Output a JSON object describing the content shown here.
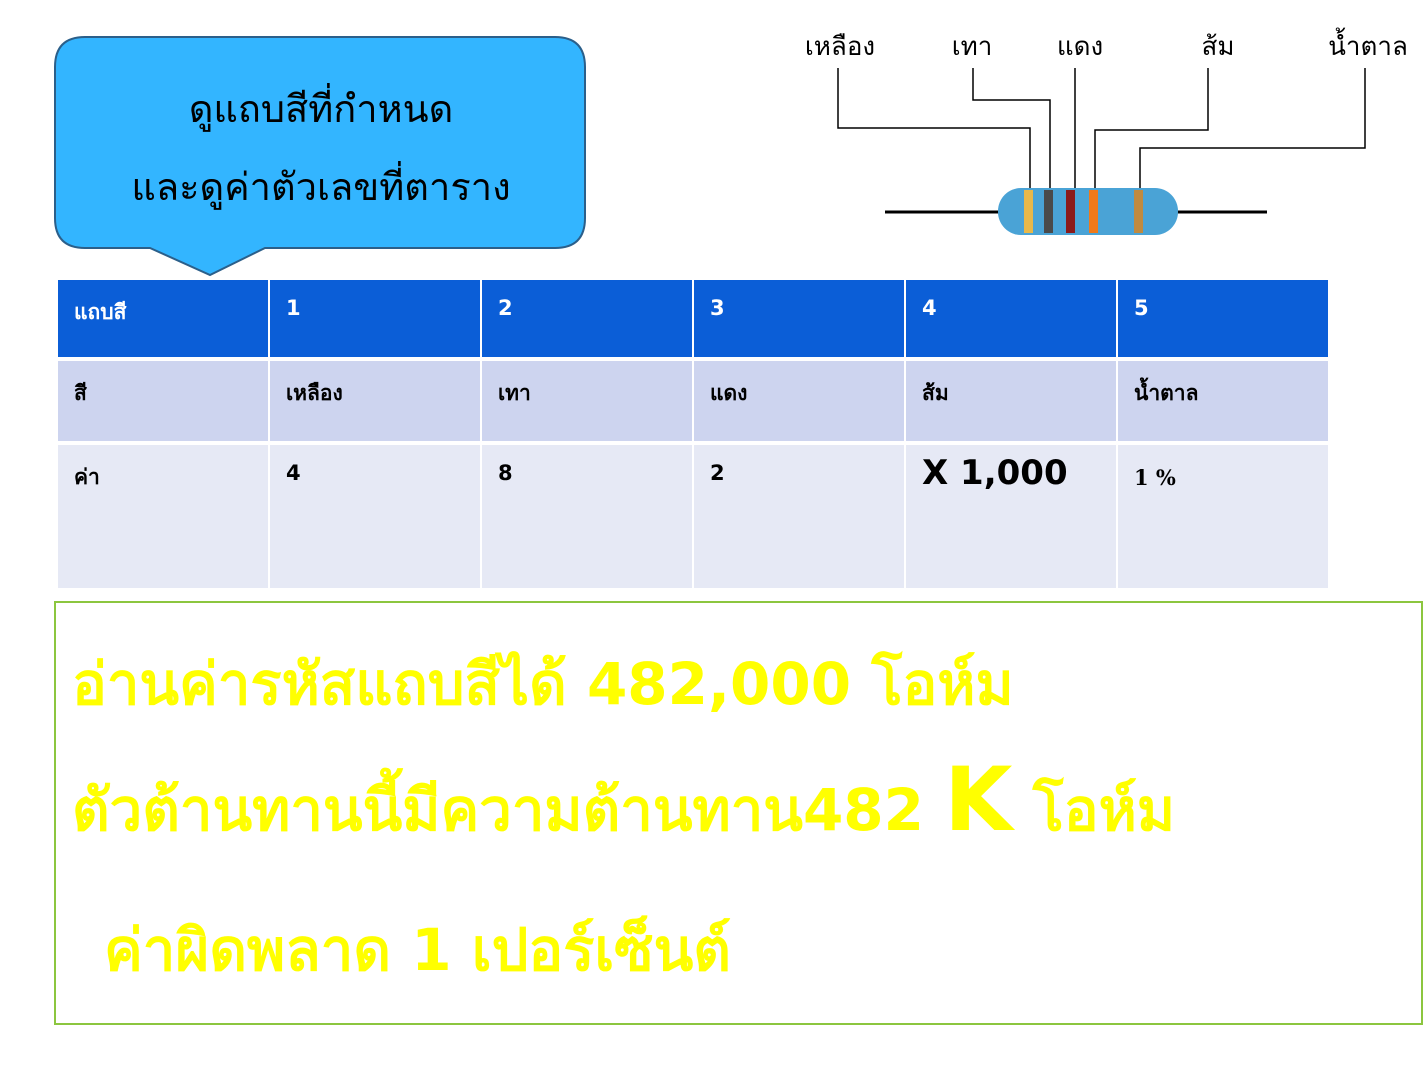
{
  "callout": {
    "line_1": "ดูแถบสีที่กำหนด",
    "line_2": "และดูค่าตัวเลขที่ตาราง",
    "fill_color": "#33b5ff",
    "border_color": "#2b5f8a"
  },
  "resistor": {
    "labels": [
      "เหลือง",
      "เทา",
      "แดง",
      "ส้ม",
      "น้ำตาล"
    ],
    "body_color": "#4aa3d6",
    "band_colors": [
      "#e8b84a",
      "#4a4a4a",
      "#8b1a1a",
      "#f07a1a",
      "#c08a40"
    ]
  },
  "table": {
    "header": [
      "แถบสี",
      "1",
      "2",
      "3",
      "4",
      "5"
    ],
    "rows": [
      [
        "สี",
        "เหลือง",
        "เทา",
        "แดง",
        "ส้ม",
        "น้ำตาล"
      ],
      [
        "ค่า",
        "4",
        "8",
        "2",
        "X 1,000",
        "1 %"
      ]
    ],
    "header_color": "#0b5ed7",
    "row_colors": [
      "#cdd4ef",
      "#e6e9f5"
    ]
  },
  "summary": {
    "line_1": "อ่านค่ารหัสแถบสีได้ 482,000 โอห์ม",
    "line_2_start": "ตัวต้านทานนี้มีความต้านทาน482 ",
    "line_2_unit": "K",
    "line_2_end": " โอห์ม",
    "line_3": "ค่าผิดพลาด 1 เปอร์เซ็นต์",
    "text_color": "#ffff00",
    "border_color": "#8cc63f"
  }
}
